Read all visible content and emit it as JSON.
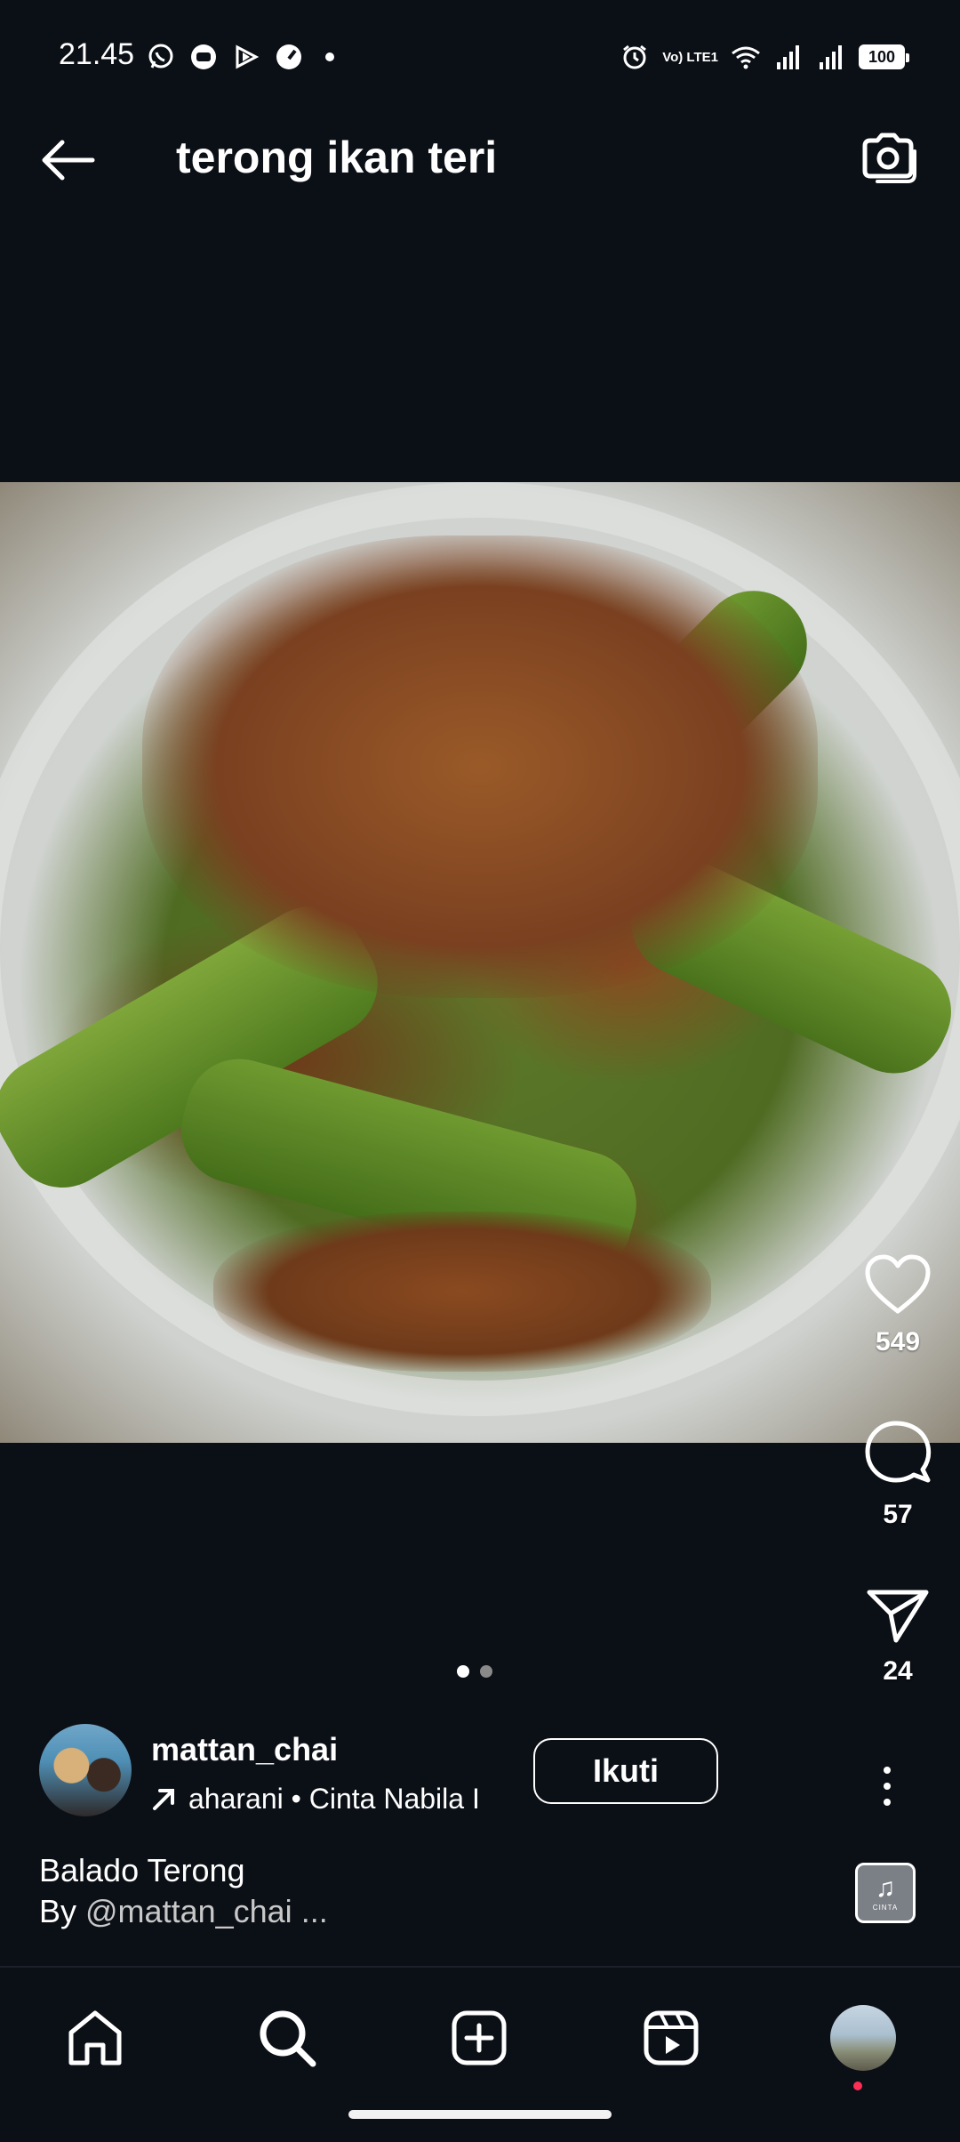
{
  "status_bar": {
    "time": "21.45",
    "network_label": "Vo) LTE1",
    "battery": "100",
    "left_icons": [
      "whatsapp-icon",
      "chat-bubble-icon",
      "play-icon",
      "speedometer-icon"
    ],
    "right_icons": [
      "alarm-icon",
      "wifi-icon",
      "signal-icon",
      "signal-icon"
    ]
  },
  "header": {
    "title": "terong ikan teri",
    "back_icon": "arrow-left-icon",
    "camera_icon": "camera-icon"
  },
  "post": {
    "image_icon": "food-photo",
    "carousel": {
      "count": 2,
      "active": 0
    },
    "likes": "549",
    "comments": "57",
    "shares": "24"
  },
  "author": {
    "username": "mattan_chai",
    "audio_text": "aharani • Cinta   Nabila I",
    "follow_label": "Ikuti"
  },
  "caption": {
    "line1": "Balado Terong",
    "by": "By ",
    "handle": "@mattan_chai",
    "more": " ..."
  },
  "music": {
    "tag": "CINTA"
  },
  "nav": {
    "items": [
      "home-icon",
      "search-icon",
      "create-icon",
      "reels-icon",
      "profile-avatar"
    ]
  },
  "colors": {
    "background": "#0b0f16",
    "text": "#ffffff",
    "notification_dot": "#ff2e55"
  }
}
